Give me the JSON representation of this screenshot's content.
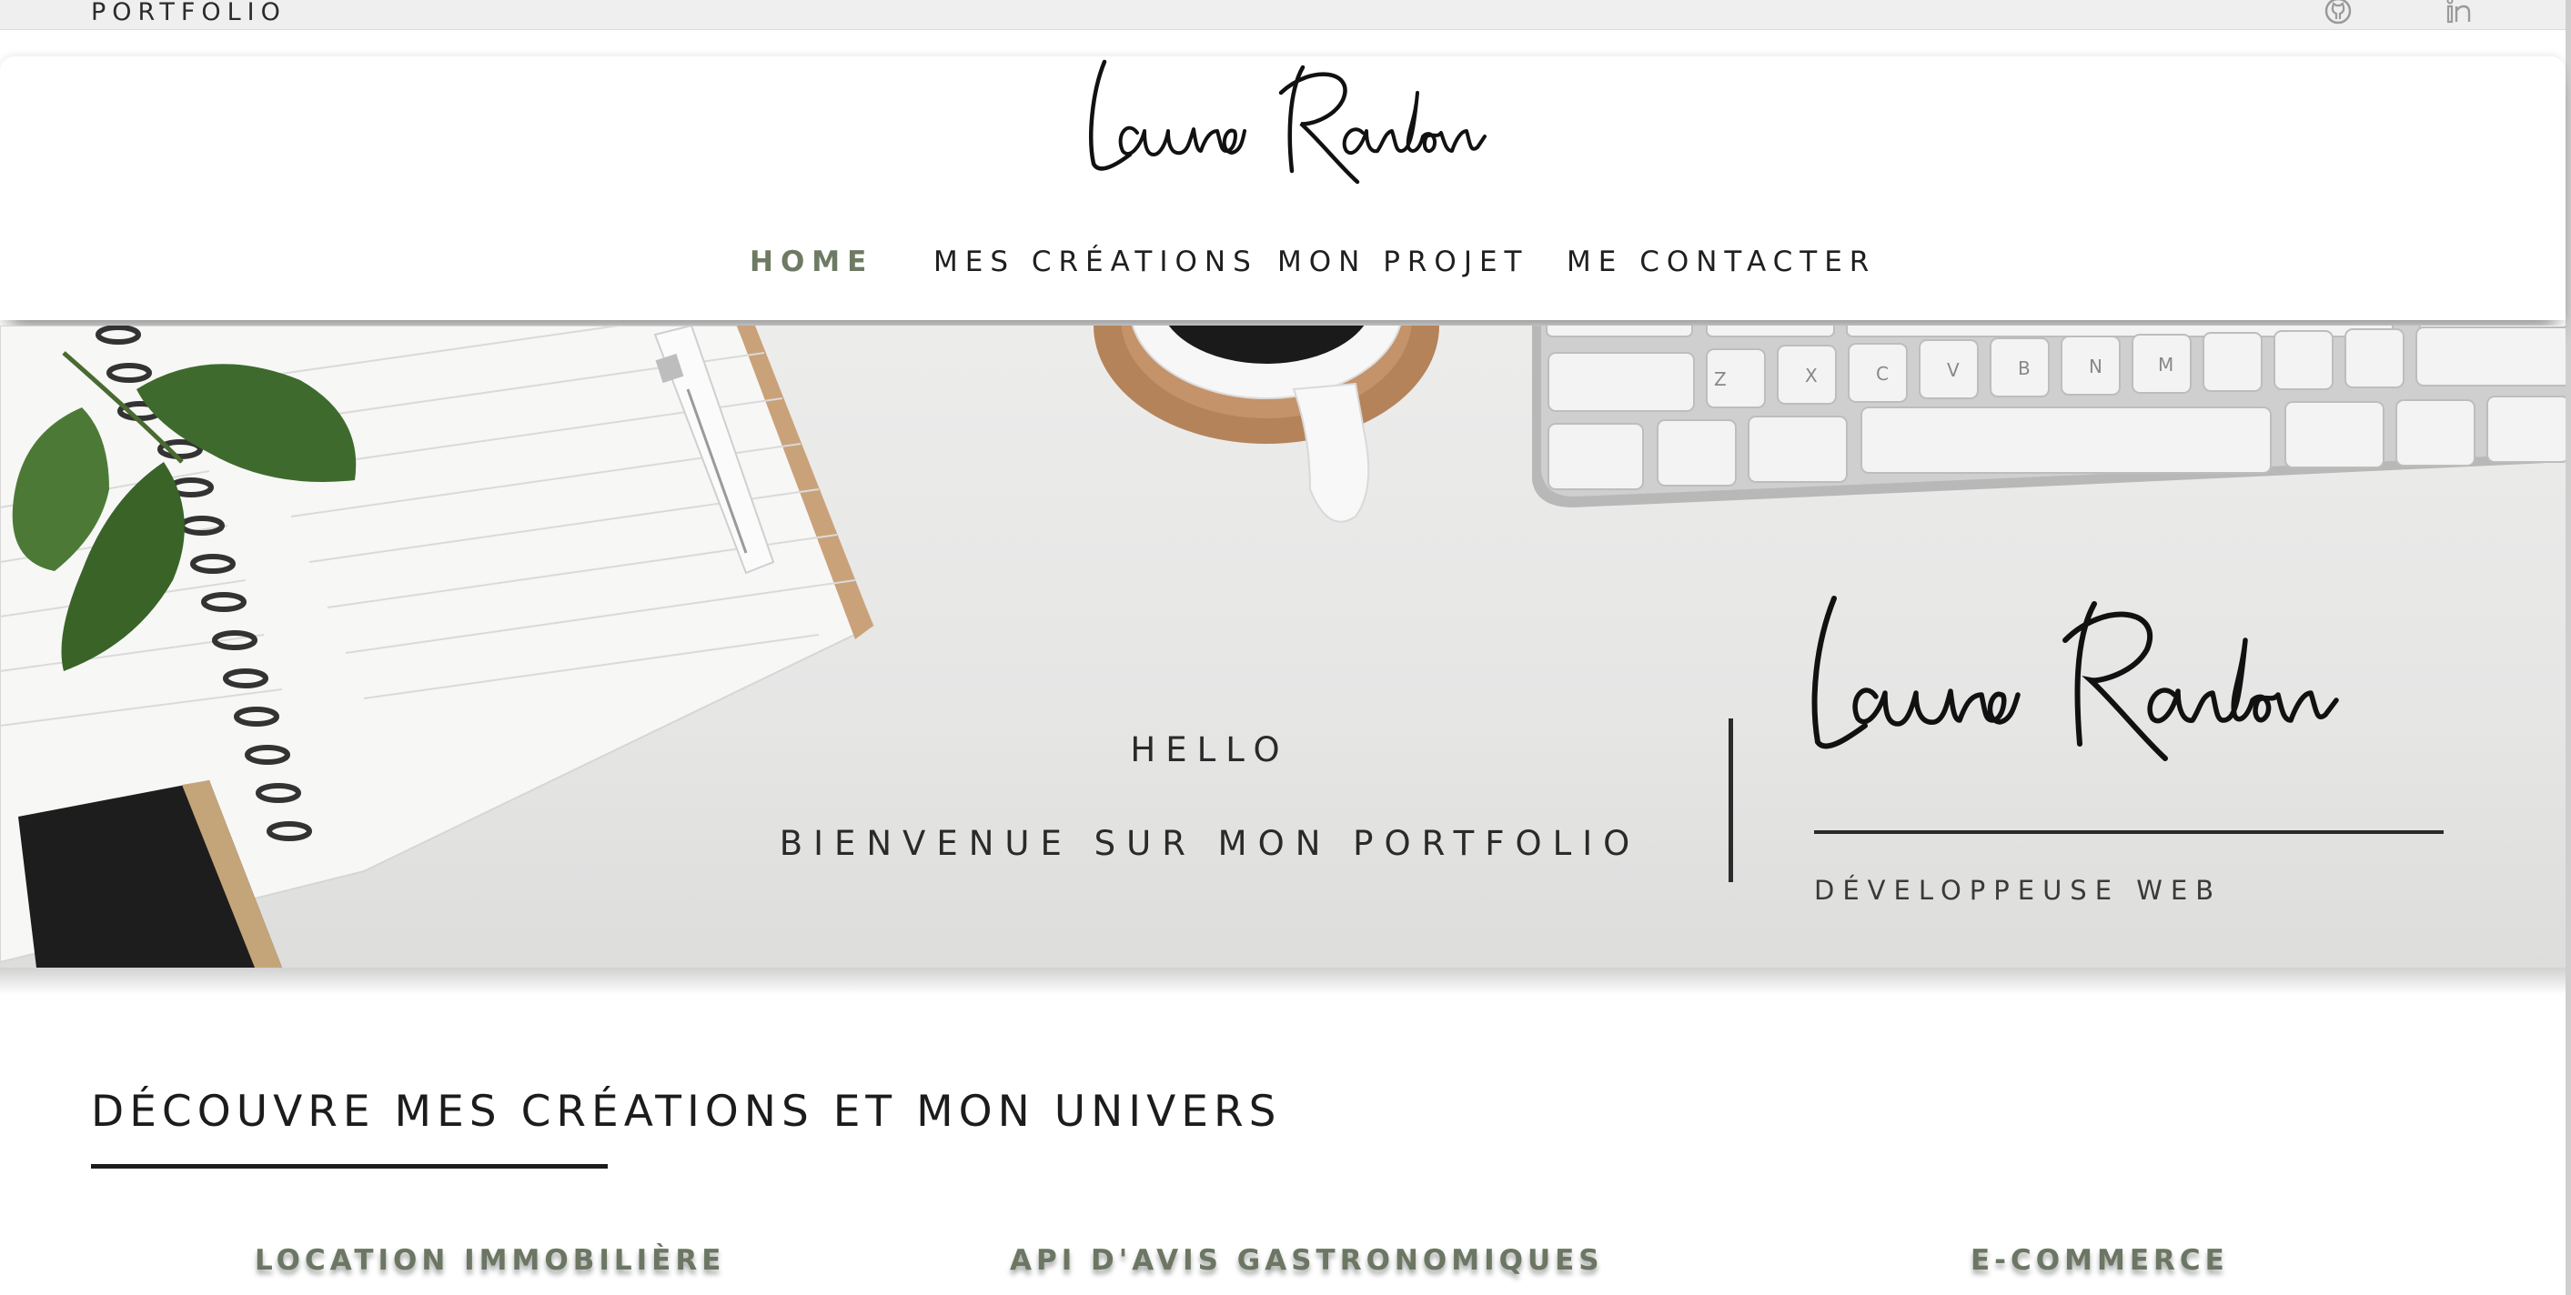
{
  "topbar": {
    "brand": "PORTFOLIO",
    "icons": [
      "github-icon",
      "linkedin-icon"
    ]
  },
  "header": {
    "logo_text": "Laura Randon",
    "nav": [
      {
        "label": "HOME",
        "active": true
      },
      {
        "label": "MES CRÉATIONS",
        "active": false
      },
      {
        "label": "MON PROJET",
        "active": false
      },
      {
        "label": "ME CONTACTER",
        "active": false
      }
    ]
  },
  "hero": {
    "hello": "HELLO",
    "welcome": "BIENVENUE SUR MON PORTFOLIO",
    "signature": "Laura Randon",
    "role": "DÉVELOPPEUSE WEB"
  },
  "section": {
    "title": "DÉCOUVRE MES CRÉATIONS ET MON UNIVERS",
    "cards": [
      {
        "title": "LOCATION IMMOBILIÈRE"
      },
      {
        "title": "API D'AVIS GASTRONOMIQUES"
      },
      {
        "title": "E-COMMERCE"
      }
    ]
  },
  "colors": {
    "accent": "#6e7a63",
    "text": "#1f1f1f",
    "background": "#ffffff",
    "hero_background": "#e8e8e7"
  }
}
